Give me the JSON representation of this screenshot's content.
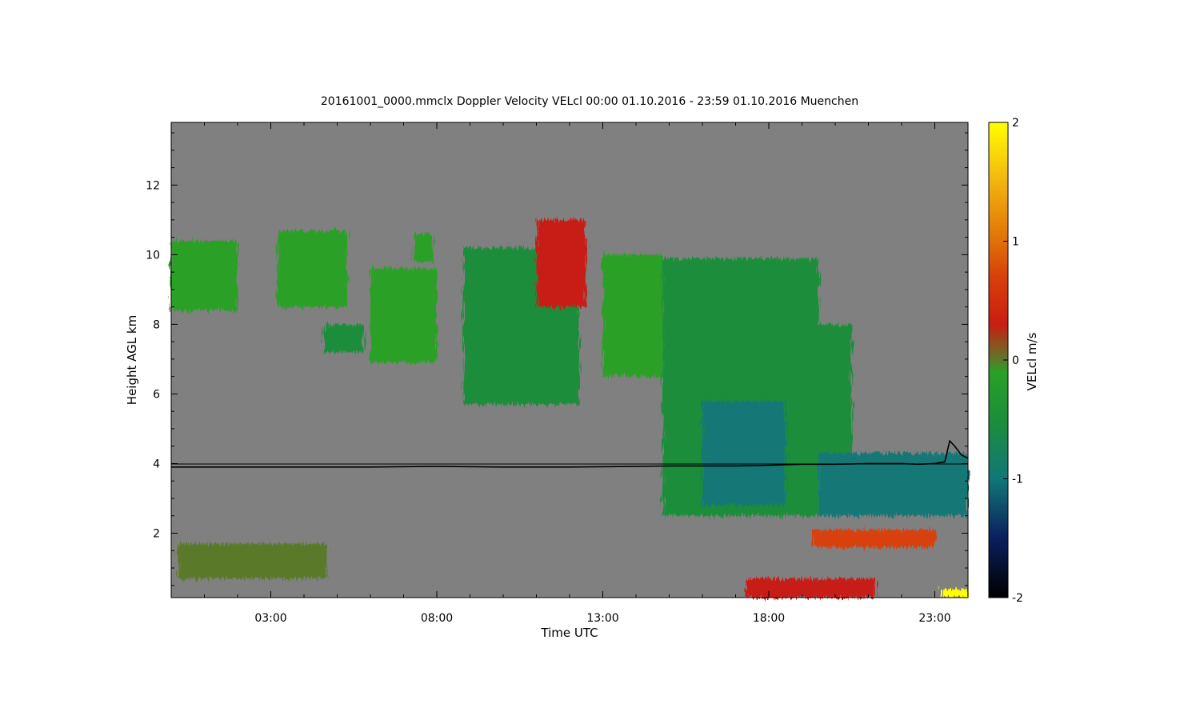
{
  "chart_data": {
    "type": "heatmap",
    "title": "20161001_0000.mmclx Doppler Velocity VELcl   00:00 01.10.2016 - 23:59 01.10.2016 Muenchen",
    "xlabel": "Time UTC",
    "ylabel": "Height AGL km",
    "x_ticks": [
      "03:00",
      "08:00",
      "13:00",
      "18:00",
      "23:00"
    ],
    "x_tick_hours": [
      3,
      8,
      13,
      18,
      23
    ],
    "xlim_hours": [
      0,
      24
    ],
    "y_ticks": [
      2,
      4,
      6,
      8,
      10,
      12
    ],
    "ylim": [
      0.15,
      13.8
    ],
    "background_color": "#808080",
    "colorbar": {
      "label": "VELcl m/s",
      "ticks": [
        -2,
        -1,
        0,
        1,
        2
      ],
      "range": [
        -2,
        2
      ],
      "stops": [
        {
          "v": -2.0,
          "color": "#000000"
        },
        {
          "v": -1.5,
          "color": "#0a1f5e"
        },
        {
          "v": -1.0,
          "color": "#127777"
        },
        {
          "v": -0.5,
          "color": "#1d8e3a"
        },
        {
          "v": -0.1,
          "color": "#2aa028"
        },
        {
          "v": 0.0,
          "color": "#5a7a2a"
        },
        {
          "v": 0.3,
          "color": "#c81e12"
        },
        {
          "v": 0.7,
          "color": "#d8400a"
        },
        {
          "v": 1.0,
          "color": "#e07008"
        },
        {
          "v": 1.5,
          "color": "#f2b40f"
        },
        {
          "v": 2.0,
          "color": "#ffff00"
        }
      ]
    },
    "echo_regions": [
      {
        "t0": 0.0,
        "t1": 2.0,
        "hbot": 8.4,
        "htop": 10.4,
        "vel": -0.3
      },
      {
        "t0": 3.2,
        "t1": 5.3,
        "hbot": 8.5,
        "htop": 10.7,
        "vel": -0.4
      },
      {
        "t0": 4.6,
        "t1": 5.8,
        "hbot": 7.2,
        "htop": 8.0,
        "vel": -0.5
      },
      {
        "t0": 6.0,
        "t1": 8.0,
        "hbot": 6.9,
        "htop": 9.6,
        "vel": -0.2
      },
      {
        "t0": 7.3,
        "t1": 7.9,
        "hbot": 9.8,
        "htop": 10.6,
        "vel": -0.3
      },
      {
        "t0": 8.8,
        "t1": 12.3,
        "hbot": 5.7,
        "htop": 10.2,
        "vel": -0.5
      },
      {
        "t0": 11.0,
        "t1": 12.5,
        "hbot": 8.5,
        "htop": 11.0,
        "vel": 0.3
      },
      {
        "t0": 13.0,
        "t1": 14.8,
        "hbot": 6.5,
        "htop": 10.0,
        "vel": -0.4
      },
      {
        "t0": 14.8,
        "t1": 19.5,
        "hbot": 2.5,
        "htop": 9.9,
        "vel": -0.7
      },
      {
        "t0": 16.0,
        "t1": 18.5,
        "hbot": 2.8,
        "htop": 5.8,
        "vel": -1.3
      },
      {
        "t0": 19.0,
        "t1": 20.5,
        "hbot": 4.3,
        "htop": 8.0,
        "vel": -0.6
      },
      {
        "t0": 19.5,
        "t1": 24.0,
        "hbot": 2.5,
        "htop": 4.3,
        "vel": -1.0
      },
      {
        "t0": 19.3,
        "t1": 23.0,
        "hbot": 1.6,
        "htop": 2.1,
        "vel": 0.4
      },
      {
        "t0": 0.2,
        "t1": 4.7,
        "hbot": 0.7,
        "htop": 1.7,
        "vel": 0.0
      },
      {
        "t0": 17.3,
        "t1": 21.2,
        "hbot": 0.15,
        "htop": 0.7,
        "vel": 0.1
      },
      {
        "t0": 23.2,
        "t1": 24.0,
        "hbot": 0.15,
        "htop": 0.4,
        "vel": 1.8
      }
    ],
    "line_series": {
      "name": "",
      "color": "#000000",
      "points": [
        [
          0.0,
          3.9
        ],
        [
          2.0,
          3.9
        ],
        [
          4.0,
          3.9
        ],
        [
          6.0,
          3.9
        ],
        [
          8.0,
          3.92
        ],
        [
          10.0,
          3.9
        ],
        [
          12.0,
          3.9
        ],
        [
          14.0,
          3.92
        ],
        [
          15.0,
          3.93
        ],
        [
          16.0,
          3.93
        ],
        [
          17.0,
          3.93
        ],
        [
          18.0,
          3.95
        ],
        [
          19.0,
          3.98
        ],
        [
          20.0,
          3.98
        ],
        [
          21.0,
          4.0
        ],
        [
          22.0,
          4.0
        ],
        [
          22.5,
          3.98
        ],
        [
          23.0,
          4.0
        ],
        [
          23.3,
          4.05
        ],
        [
          23.45,
          4.65
        ],
        [
          23.6,
          4.5
        ],
        [
          23.8,
          4.25
        ],
        [
          24.0,
          4.15
        ]
      ]
    }
  }
}
